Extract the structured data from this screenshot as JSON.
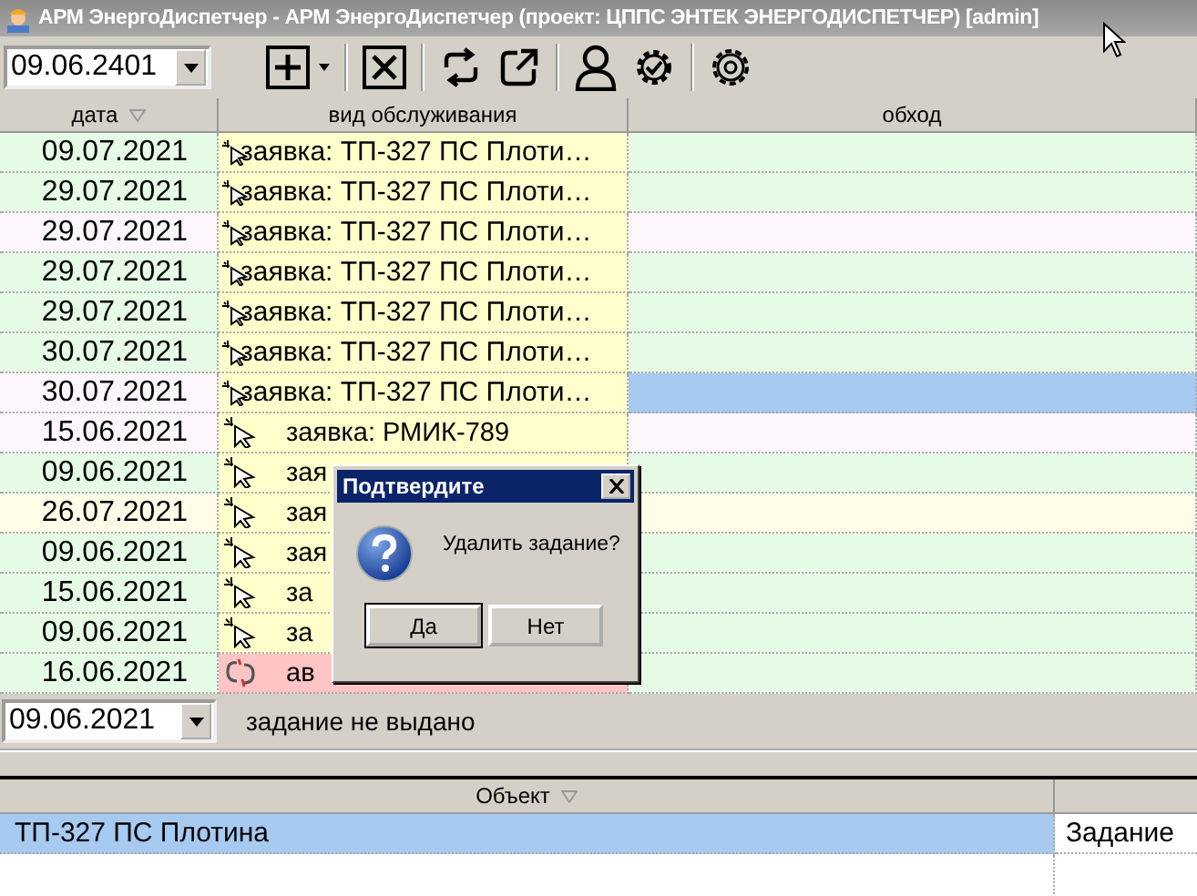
{
  "window": {
    "title": "АРМ ЭнергоДиспетчер - АРМ ЭнергоДиспетчер (проект: ЦППС ЭНТЕК ЭНЕРГОДИСПЕТЧЕР) [admin]"
  },
  "toolbar": {
    "date": "09.06.2401"
  },
  "table": {
    "columns": [
      "дата",
      "вид обслуживания",
      "обход"
    ],
    "rows": [
      {
        "date": "09.07.2021",
        "type": "заявка: ТП-327 ПС Плоти…",
        "kind": "pointer-sparkle",
        "color": "#e6fbe6",
        "selected": false
      },
      {
        "date": "29.07.2021",
        "type": "заявка: ТП-327 ПС Плоти…",
        "kind": "pointer-sparkle",
        "color": "#e6fbe6",
        "selected": false
      },
      {
        "date": "29.07.2021",
        "type": "заявка: ТП-327 ПС Плоти…",
        "kind": "pointer-sparkle",
        "color": "#fdf7fd",
        "selected": false
      },
      {
        "date": "29.07.2021",
        "type": "заявка: ТП-327 ПС Плоти…",
        "kind": "pointer-sparkle",
        "color": "#e6fbe6",
        "selected": false
      },
      {
        "date": "29.07.2021",
        "type": "заявка: ТП-327 ПС Плоти…",
        "kind": "pointer-sparkle",
        "color": "#e6fbe6",
        "selected": false
      },
      {
        "date": "30.07.2021",
        "type": "заявка: ТП-327 ПС Плоти…",
        "kind": "pointer-sparkle",
        "color": "#e6fbe6",
        "selected": false
      },
      {
        "date": "30.07.2021",
        "type": "заявка: ТП-327 ПС Плоти…",
        "kind": "pointer-sparkle",
        "color": "#fdf7fd",
        "selected": true
      },
      {
        "date": "15.06.2021",
        "type": "заявка: РМИК-789",
        "kind": "pointer",
        "color": "#fdf7fd",
        "selected": false
      },
      {
        "date": "09.06.2021",
        "type": "зая",
        "kind": "pointer",
        "color": "#e6fbe6",
        "selected": false
      },
      {
        "date": "26.07.2021",
        "type": "зая",
        "kind": "pointer",
        "color": "#fffde8",
        "selected": false
      },
      {
        "date": "09.06.2021",
        "type": "зая",
        "kind": "pointer",
        "color": "#e6fbe6",
        "selected": false
      },
      {
        "date": "15.06.2021",
        "type": "за",
        "kind": "pointer",
        "color": "#e6fbe6",
        "selected": false
      },
      {
        "date": "09.06.2021",
        "type": "за",
        "kind": "pointer",
        "color": "#e6fbe6",
        "selected": false
      },
      {
        "date": "16.06.2021",
        "type": "ав",
        "kind": "broken-link",
        "color": "#e6fbe6",
        "selected": false
      }
    ]
  },
  "status": {
    "date": "09.06.2021",
    "text": "задание не выдано"
  },
  "objects": {
    "columns": [
      "Объект"
    ],
    "rows": [
      {
        "name": "ТП-327 ПС Плотина",
        "task": "Задание",
        "selected": true
      }
    ]
  },
  "dialog": {
    "title": "Подтвердите",
    "message": "Удалить задание?",
    "buttons": [
      {
        "label": "Да",
        "default": true
      },
      {
        "label": "Нет",
        "default": false
      }
    ]
  }
}
